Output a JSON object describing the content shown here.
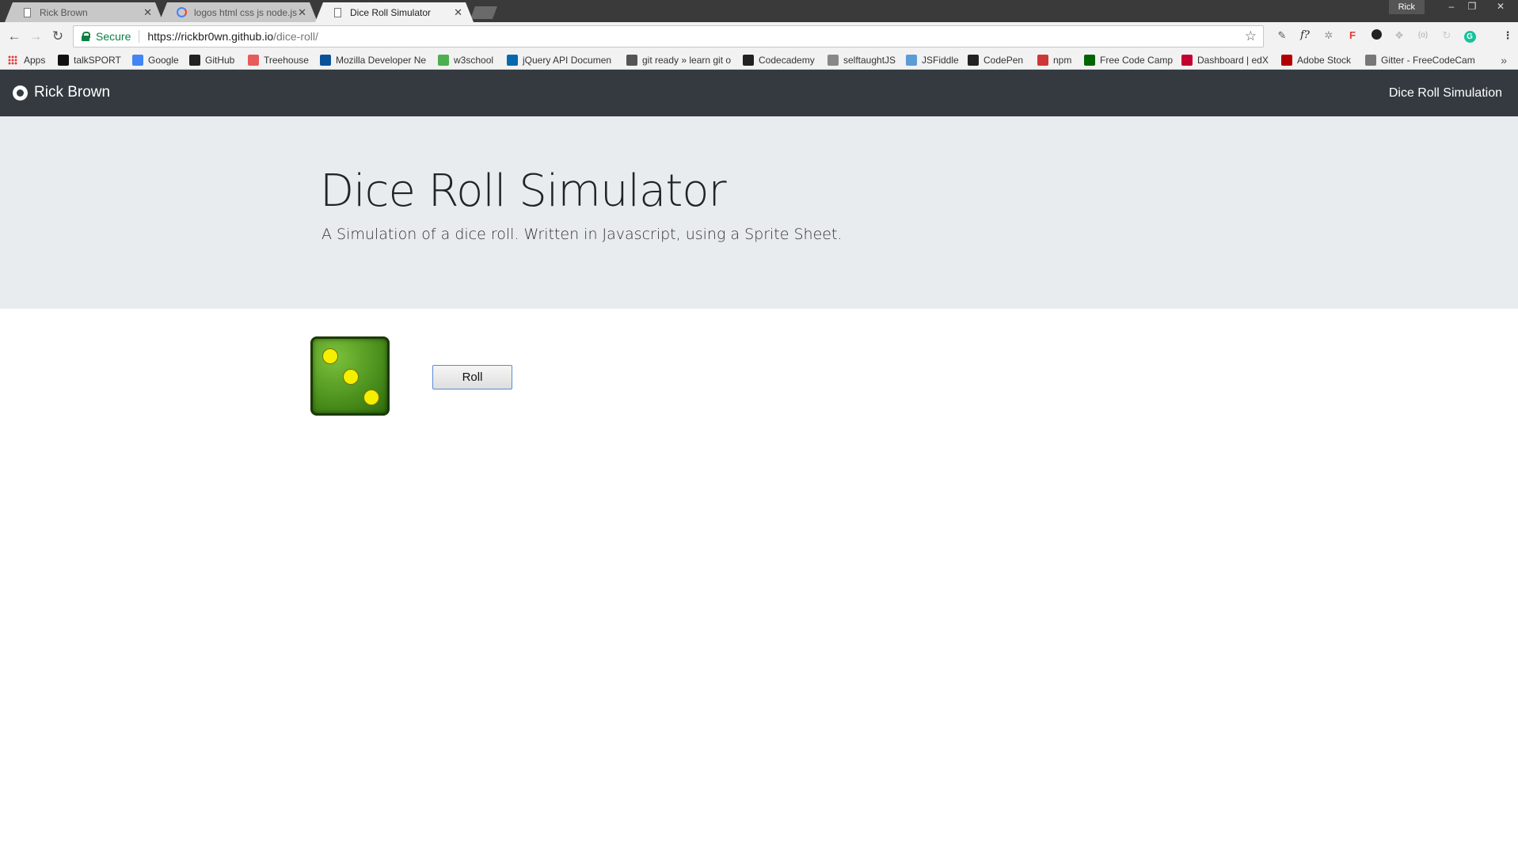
{
  "browser": {
    "tabs": [
      {
        "label": "Rick Brown",
        "icon": "page-icon"
      },
      {
        "label": "logos html css js node.js",
        "icon": "google-icon"
      },
      {
        "label": "Dice Roll Simulator",
        "icon": "page-icon"
      }
    ],
    "profile_name": "Rick",
    "window_controls": {
      "minimize": "–",
      "restore": "❐",
      "close": "✕"
    },
    "secure_label": "Secure",
    "url_host": "https://rickbr0wn.github.io",
    "url_path": "/dice-roll/",
    "bookmarks": [
      {
        "label": "Apps",
        "icon": "apps-icon",
        "color": "#e53935"
      },
      {
        "label": "talkSPORT",
        "icon": "talksport-icon",
        "color": "#111111"
      },
      {
        "label": "Google",
        "icon": "google-icon",
        "color": "#4285f4"
      },
      {
        "label": "GitHub",
        "icon": "github-icon",
        "color": "#222222"
      },
      {
        "label": "Treehouse",
        "icon": "treehouse-icon",
        "color": "#e65c5c"
      },
      {
        "label": "Mozilla Developer Ne",
        "icon": "mozilla-icon",
        "color": "#0c5299"
      },
      {
        "label": "w3school",
        "icon": "w3school-icon",
        "color": "#4caf50"
      },
      {
        "label": "jQuery API Documen",
        "icon": "jquery-icon",
        "color": "#0769ad"
      },
      {
        "label": "git ready » learn git o",
        "icon": "gitready-icon",
        "color": "#555555"
      },
      {
        "label": "Codecademy",
        "icon": "codecademy-icon",
        "color": "#222222"
      },
      {
        "label": "selftaughtJS",
        "icon": "selftaught-icon",
        "color": "#888888"
      },
      {
        "label": "JSFiddle",
        "icon": "jsfiddle-icon",
        "color": "#5d9bd6"
      },
      {
        "label": "CodePen",
        "icon": "codepen-icon",
        "color": "#222222"
      },
      {
        "label": "npm",
        "icon": "npm-icon",
        "color": "#cb3837"
      },
      {
        "label": "Free Code Camp",
        "icon": "freecodecamp-icon",
        "color": "#006400"
      },
      {
        "label": "Dashboard | edX",
        "icon": "edx-icon",
        "color": "#c3002f"
      },
      {
        "label": "Adobe Stock",
        "icon": "adobestock-icon",
        "color": "#b30000"
      },
      {
        "label": "Gitter - FreeCodeCam",
        "icon": "gitter-icon",
        "color": "#777777"
      }
    ]
  },
  "site": {
    "brand": "Rick Brown",
    "nav_link": "Dice Roll Simulation",
    "title": "Dice Roll Simulator",
    "lead": "A Simulation of a dice roll. Written in Javascript, using a Sprite Sheet.",
    "die_value": 3,
    "roll_label": "Roll"
  },
  "colors": {
    "navbar": "#343a40",
    "jumbotron": "#e9ecef",
    "die": "#4a8f1c",
    "pip": "#f5ef00",
    "secure": "#0b8043"
  }
}
